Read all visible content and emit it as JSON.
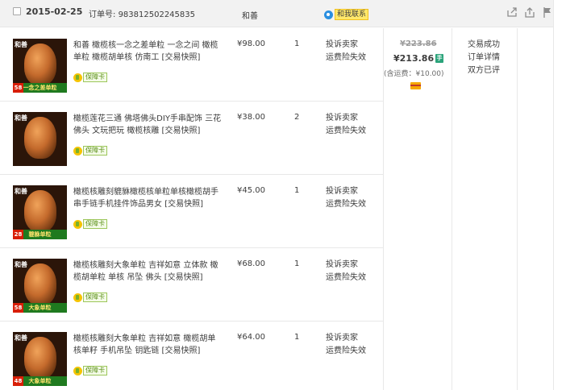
{
  "header": {
    "date": "2015-02-25",
    "order_label": "订单号:",
    "order_number": "983812502245835",
    "seller": "和善",
    "contact_label": "和我联系"
  },
  "icons": {
    "share": "share-icon",
    "upload": "upload-icon",
    "flag": "flag-icon",
    "contact": "contact-icon",
    "insurance": "insurance-icon",
    "phone": "phone-icon",
    "card": "card-icon"
  },
  "items": [
    {
      "title": "和善 橄榄核一念之差单粒 一念之间 橄榄单粒 橄榄胡单核 仿南工",
      "snapshot": "[交易快照]",
      "insurance": "保障卡",
      "price": "¥98.00",
      "quantity": "1",
      "complaint": "投诉卖家",
      "freight_insurance": "运费险失效",
      "thumb_banner": "一念之差单粒",
      "thumb_badge": "58",
      "thumb_seal": "和善"
    },
    {
      "title": "橄榄莲花三通 佛塔佛头DIY手串配饰 三花佛头 文玩把玩 橄榄核雕",
      "snapshot": "[交易快照]",
      "insurance": "保障卡",
      "price": "¥38.00",
      "quantity": "2",
      "complaint": "投诉卖家",
      "freight_insurance": "运费险失效",
      "thumb_banner": "",
      "thumb_badge": "",
      "thumb_seal": "和善"
    },
    {
      "title": "橄榄核雕刻貔貅橄榄核单粒单核橄榄胡手串手链手机挂件饰品男女",
      "snapshot": "[交易快照]",
      "insurance": "保障卡",
      "price": "¥45.00",
      "quantity": "1",
      "complaint": "投诉卖家",
      "freight_insurance": "运费险失效",
      "thumb_banner": "貔貅单粒",
      "thumb_badge": "28",
      "thumb_seal": "和善"
    },
    {
      "title": "橄榄核雕刻大象单粒 吉祥如意 立体款 橄榄胡单粒 单核 吊坠 佛头",
      "snapshot": "[交易快照]",
      "insurance": "保障卡",
      "price": "¥68.00",
      "quantity": "1",
      "complaint": "投诉卖家",
      "freight_insurance": "运费险失效",
      "thumb_banner": "大象单粒",
      "thumb_badge": "58",
      "thumb_seal": "和善"
    },
    {
      "title": "橄榄核雕刻大象单粒 吉祥如意 橄榄胡单核单籽 手机吊坠 钥匙链",
      "snapshot": "[交易快照]",
      "insurance": "保障卡",
      "price": "¥64.00",
      "quantity": "1",
      "complaint": "投诉卖家",
      "freight_insurance": "运费险失效",
      "thumb_banner": "大象单粒",
      "thumb_badge": "48",
      "thumb_seal": "和善"
    }
  ],
  "totals": {
    "original": "¥223.86",
    "actual": "¥213.86",
    "shipping": "(含运费：¥10.00)",
    "phone_badge": "手"
  },
  "status": {
    "result": "交易成功",
    "details": "订单详情",
    "review": "双方已评"
  },
  "colors": {
    "header_bg": "#f2f2f2",
    "contact_bg": "#ffe86a",
    "insurance_green": "#5a8f17",
    "badge_red": "#d81e06"
  }
}
